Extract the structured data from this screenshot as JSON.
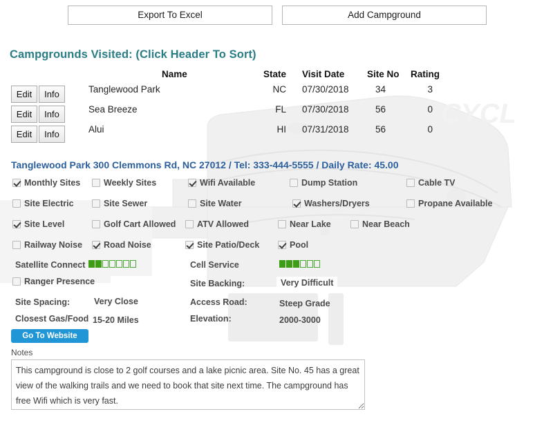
{
  "toolbar": {
    "export_label": "Export To Excel",
    "add_label": "Add Campground"
  },
  "visited": {
    "title": "Campgrounds Visited: (Click Header To Sort)",
    "columns": {
      "name": "Name",
      "state": "State",
      "visit_date": "Visit Date",
      "site_no": "Site No",
      "rating": "Rating"
    },
    "row_actions": {
      "edit": "Edit",
      "info": "Info"
    },
    "rows": [
      {
        "name": "Tanglewood Park",
        "state": "NC",
        "visit_date": "07/30/2018",
        "site_no": "34",
        "rating": "3"
      },
      {
        "name": "Sea Breeze",
        "state": "FL",
        "visit_date": "07/30/2018",
        "site_no": "56",
        "rating": "0"
      },
      {
        "name": "Alui",
        "state": "HI",
        "visit_date": "07/31/2018",
        "site_no": "56",
        "rating": "0"
      }
    ]
  },
  "detail": {
    "headline": "Tanglewood Park 300 Clemmons Rd, NC 27012 / Tel: 333-444-5555 / Daily Rate: 45.00",
    "amenities": [
      {
        "label": "Monthly Sites",
        "checked": true
      },
      {
        "label": "Weekly Sites",
        "checked": false
      },
      {
        "label": "Wifi Available",
        "checked": true
      },
      {
        "label": "Dump Station",
        "checked": false
      },
      {
        "label": "Cable TV",
        "checked": false
      },
      {
        "label": "Site Electric",
        "checked": false
      },
      {
        "label": "Site Sewer",
        "checked": false
      },
      {
        "label": "Site Water",
        "checked": false
      },
      {
        "label": "Washers/Dryers",
        "checked": true
      },
      {
        "label": "Propane Available",
        "checked": false
      },
      {
        "label": "Site Level",
        "checked": true
      },
      {
        "label": "Golf Cart Allowed",
        "checked": false
      },
      {
        "label": "ATV Allowed",
        "checked": false
      },
      {
        "label": "Near Lake",
        "checked": false
      },
      {
        "label": "Near Beach",
        "checked": false
      },
      {
        "label": "Railway Noise",
        "checked": false
      },
      {
        "label": "Road Noise",
        "checked": true
      },
      {
        "label": "Site Patio/Deck",
        "checked": true
      },
      {
        "label": "Pool",
        "checked": true
      },
      {
        "label": "Ranger Presence",
        "checked": false
      }
    ],
    "meters": {
      "satellite_label": "Satellite Connect",
      "satellite_filled": 2,
      "satellite_total": 7,
      "cell_label": "Cell Service",
      "cell_filled": 3,
      "cell_total": 6
    },
    "fields": {
      "site_backing_label": "Site Backing:",
      "site_backing_value": "Very Difficult",
      "site_spacing_label": "Site Spacing:",
      "site_spacing_value": "Very Close",
      "access_road_label": "Access Road:",
      "access_road_value": "Steep Grade",
      "closest_gas_label": "Closest Gas/Food",
      "closest_gas_value": "15-20 Miles",
      "elevation_label": "Elevation:",
      "elevation_value": "2000-3000"
    },
    "website_button": "Go To Website",
    "notes_label": "Notes",
    "notes_value": "This campground is close to 2 golf courses and a lake picnic area. Site No. 45 has a great view of the walking trails and we need to book that site next time. The campground has free Wifi which is very fast."
  },
  "colors": {
    "section_title": "#2a7d86",
    "detail_headline": "#2b5f9e",
    "meter_green": "#3d9e16",
    "website_button": "#2196d6"
  }
}
